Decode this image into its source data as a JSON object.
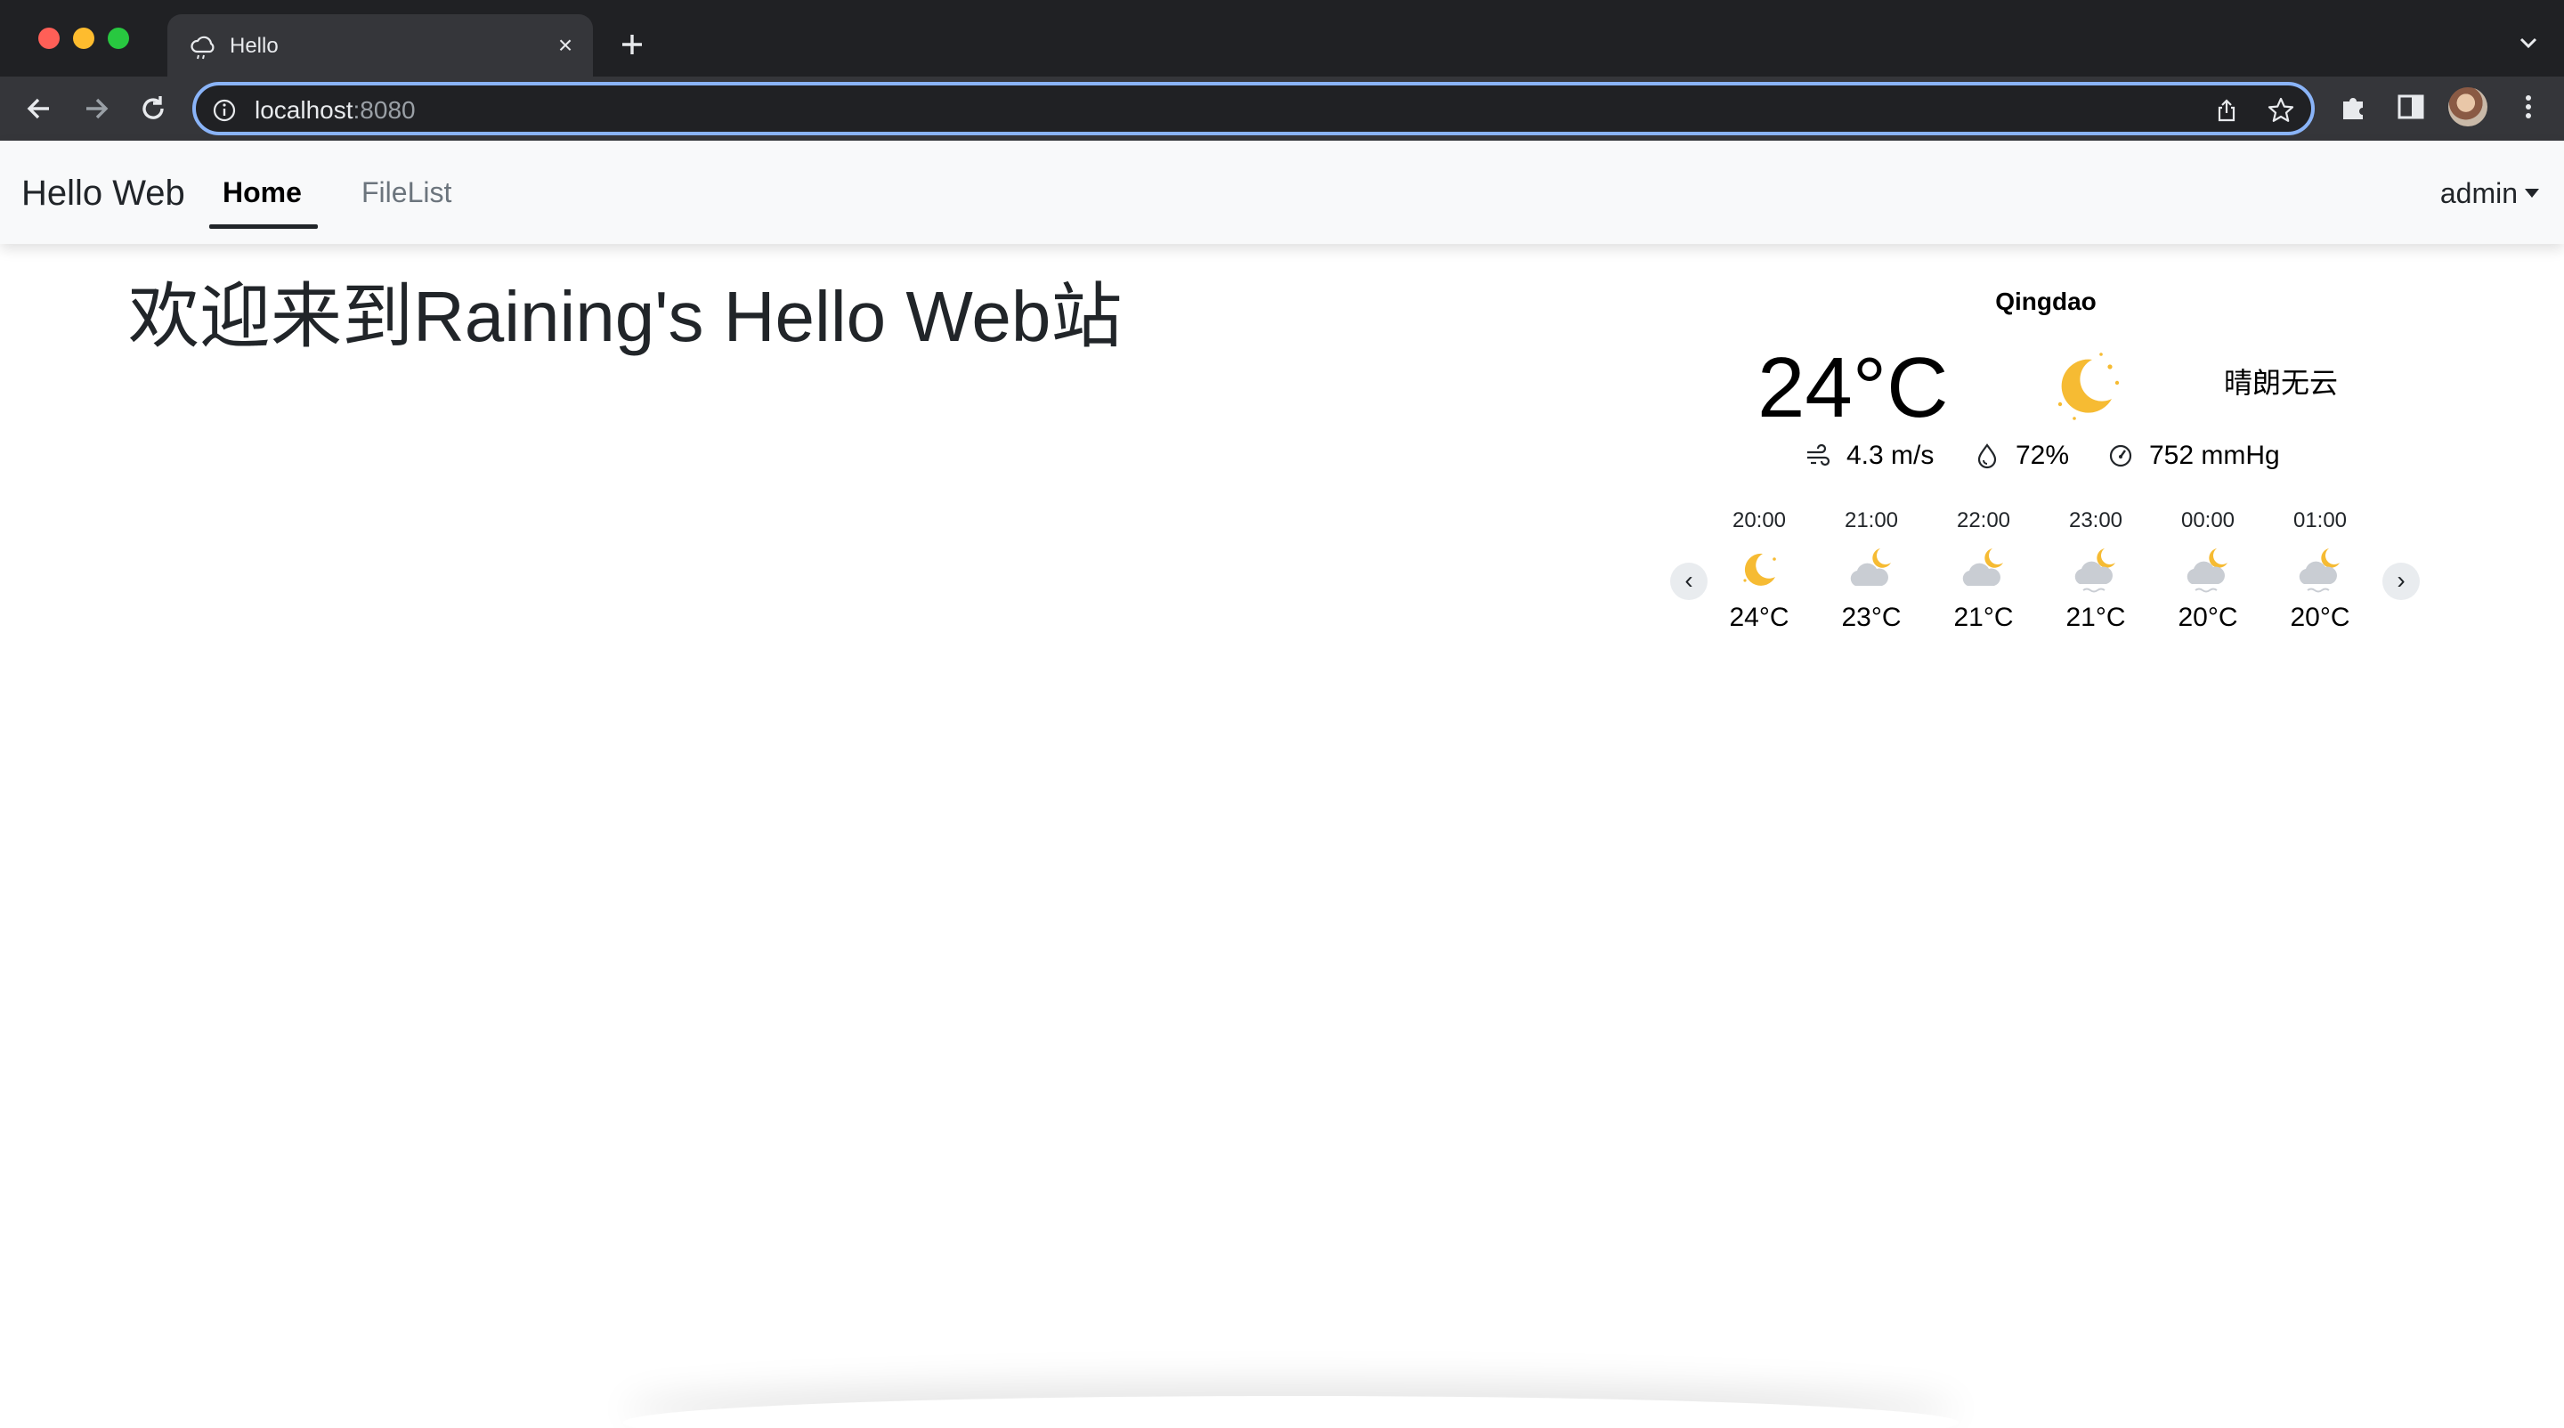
{
  "browser": {
    "tab_title": "Hello",
    "url_host": "localhost",
    "url_port": ":8080"
  },
  "navbar": {
    "brand": "Hello Web",
    "links": [
      {
        "label": "Home",
        "active": true
      },
      {
        "label": "FileList",
        "active": false
      }
    ],
    "user": "admin"
  },
  "main": {
    "heading": "欢迎来到Raining's Hello Web站"
  },
  "weather": {
    "city": "Qingdao",
    "temperature": "24°C",
    "description": "晴朗无云",
    "wind": "4.3 m/s",
    "humidity": "72%",
    "pressure": "752 mmHg",
    "prev_label": "‹",
    "next_label": "›",
    "hourly": [
      {
        "time": "20:00",
        "temp": "24°C",
        "icon": "moon-icon"
      },
      {
        "time": "21:00",
        "temp": "23°C",
        "icon": "cloud-moon-icon"
      },
      {
        "time": "22:00",
        "temp": "21°C",
        "icon": "cloud-moon-icon"
      },
      {
        "time": "23:00",
        "temp": "21°C",
        "icon": "cloud-moon-fog-icon"
      },
      {
        "time": "00:00",
        "temp": "20°C",
        "icon": "cloud-moon-fog-icon"
      },
      {
        "time": "01:00",
        "temp": "20°C",
        "icon": "cloud-moon-fog-icon"
      }
    ]
  },
  "colors": {
    "accent_focus": "#8ab4f8",
    "sun_yellow": "#f6bb33",
    "cloud_gray": "#c9cdd3"
  }
}
